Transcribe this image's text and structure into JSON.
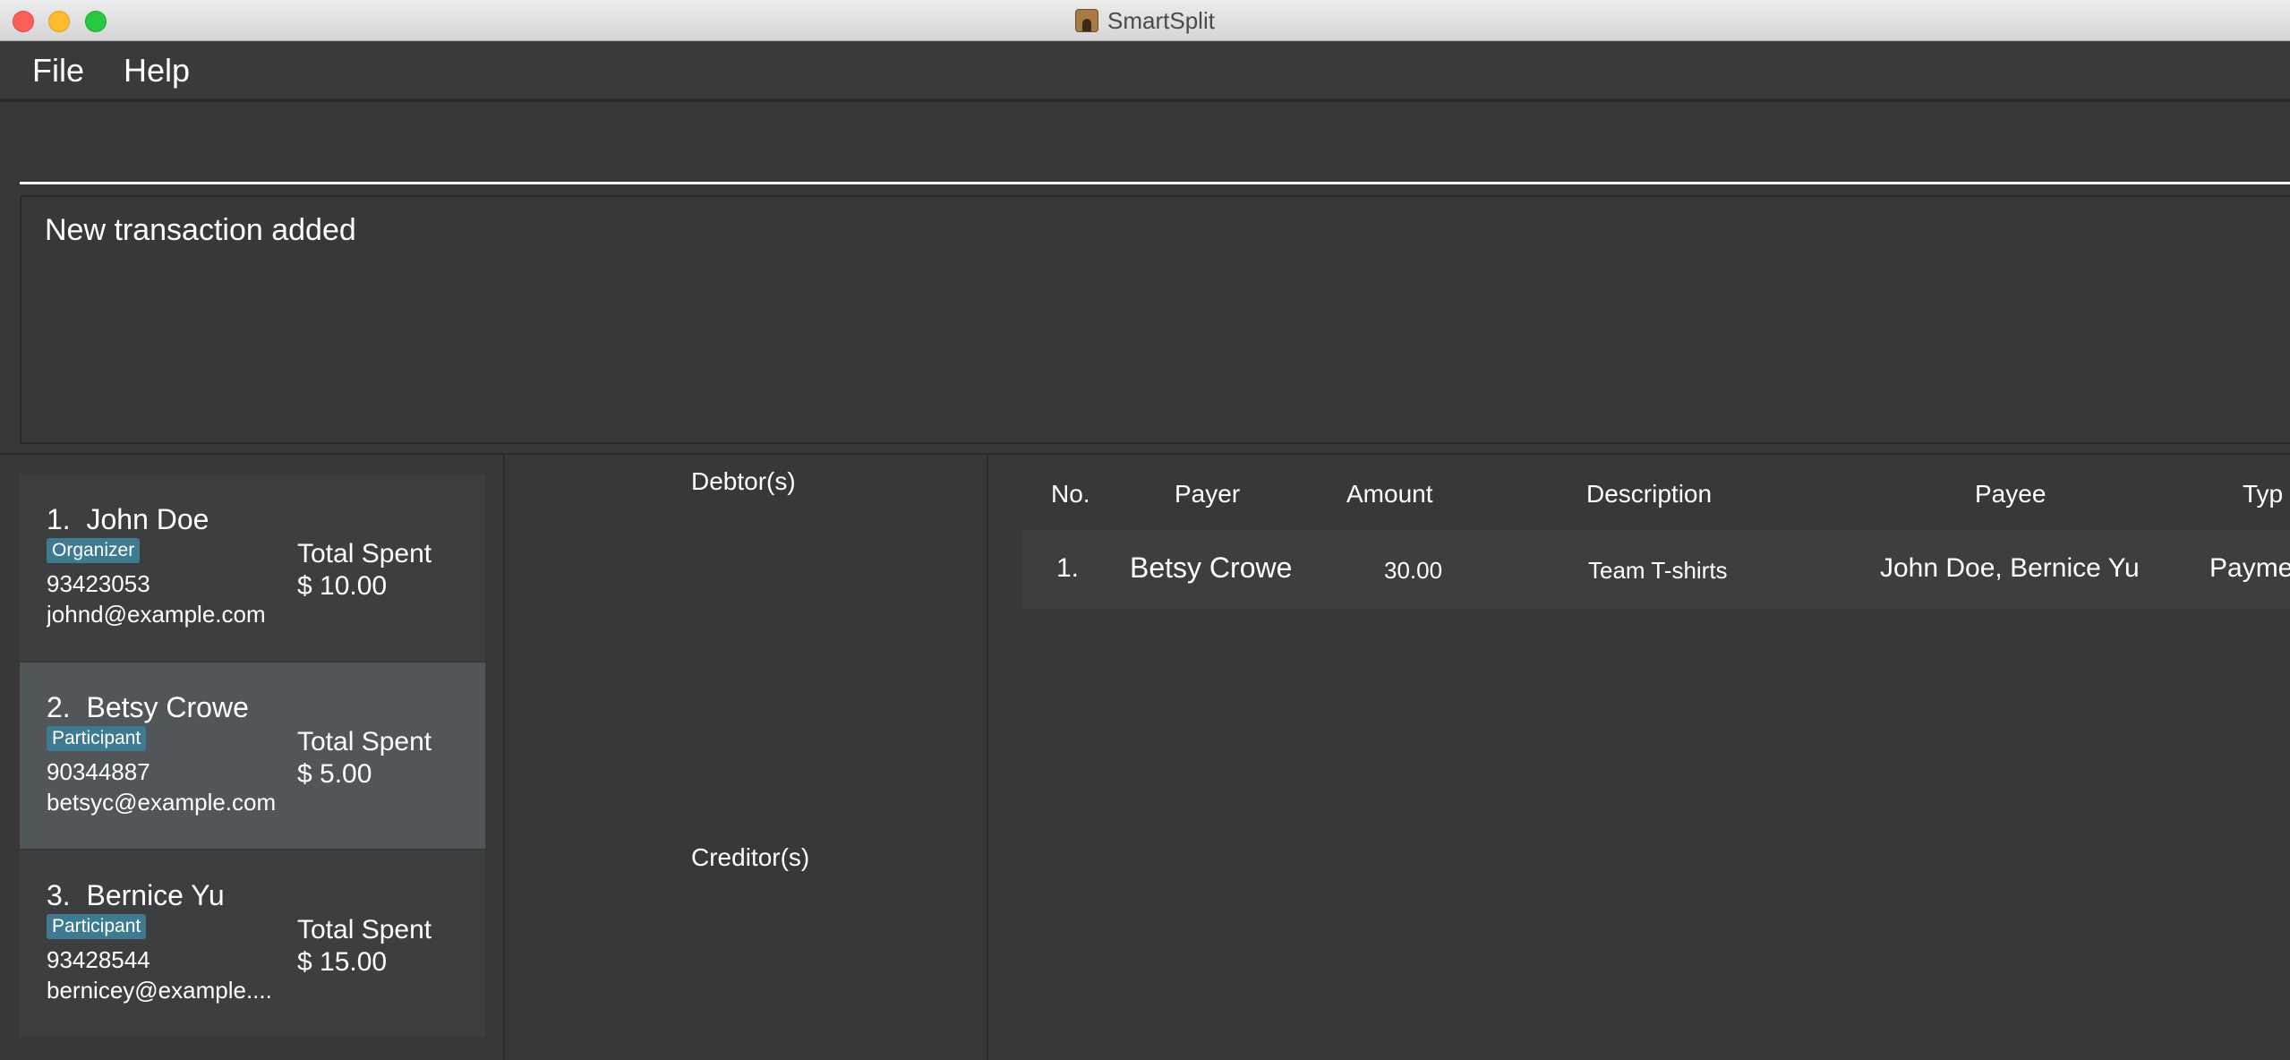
{
  "window": {
    "title": "SmartSplit"
  },
  "menu": {
    "file": "File",
    "help": "Help"
  },
  "command": {
    "value": ""
  },
  "result": {
    "message": "New transaction added"
  },
  "persons": [
    {
      "index": "1.",
      "name": "John Doe",
      "role": "Organizer",
      "phone": "93423053",
      "email": "johnd@example.com",
      "total_label": "Total Spent",
      "total_value": "$ 10.00",
      "selected": false
    },
    {
      "index": "2.",
      "name": "Betsy Crowe",
      "role": "Participant",
      "phone": "90344887",
      "email": "betsyc@example.com",
      "total_label": "Total Spent",
      "total_value": "$ 5.00",
      "selected": true
    },
    {
      "index": "3.",
      "name": "Bernice Yu",
      "role": "Participant",
      "phone": "93428544",
      "email": "bernicey@example....",
      "total_label": "Total Spent",
      "total_value": "$ 15.00",
      "selected": false
    }
  ],
  "balances": {
    "debtors_label": "Debtor(s)",
    "creditors_label": "Creditor(s)"
  },
  "transactions": {
    "headers": {
      "no": "No.",
      "payer": "Payer",
      "amount": "Amount",
      "description": "Description",
      "payee": "Payee",
      "type": "Typ"
    },
    "rows": [
      {
        "no": "1.",
        "payer": "Betsy Crowe",
        "amount": "30.00",
        "description": "Team T-shirts",
        "payee": "John Doe, Bernice Yu",
        "type": "Payme"
      }
    ]
  }
}
